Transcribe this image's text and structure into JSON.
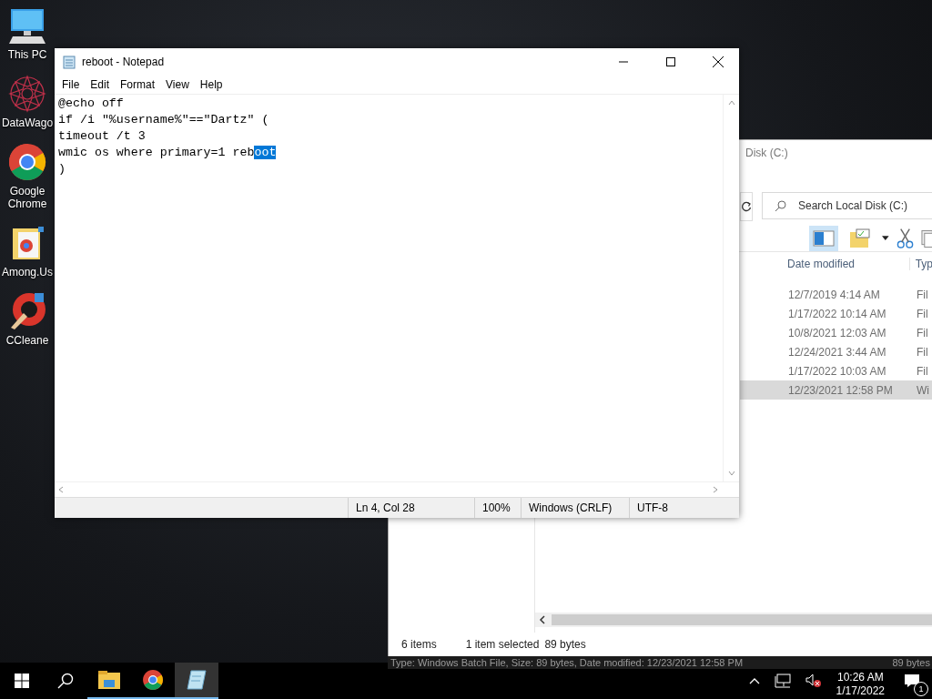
{
  "desktop_icons": [
    {
      "kind": "pc",
      "label": "This PC"
    },
    {
      "kind": "mandala",
      "label": "DataWago"
    },
    {
      "kind": "chrome",
      "label": "Google Chrome"
    },
    {
      "kind": "folder",
      "label": "Among.Us"
    },
    {
      "kind": "ccleaner",
      "label": "CCleane"
    }
  ],
  "explorer": {
    "title": "Disk (C:)",
    "search": {
      "placeholder": "Search Local Disk (C:)"
    },
    "columns": [
      "Date modified",
      "Typ"
    ],
    "rows": [
      {
        "date": "12/7/2019 4:14 AM",
        "type": "Fil",
        "selected": false
      },
      {
        "date": "1/17/2022 10:14 AM",
        "type": "Fil",
        "selected": false
      },
      {
        "date": "10/8/2021 12:03 AM",
        "type": "Fil",
        "selected": false
      },
      {
        "date": "12/24/2021 3:44 AM",
        "type": "Fil",
        "selected": false
      },
      {
        "date": "1/17/2022 10:03 AM",
        "type": "Fil",
        "selected": false
      },
      {
        "date": "12/23/2021 12:58 PM",
        "type": "Wi",
        "selected": true
      }
    ],
    "status": {
      "count": "6 items",
      "selection": "1 item selected",
      "size": "89 bytes"
    }
  },
  "tooltip": {
    "text": "Type: Windows Batch File, Size: 89 bytes, Date modified: 12/23/2021 12:58 PM",
    "extra": "89 bytes"
  },
  "notepad": {
    "title": "reboot - Notepad",
    "menu": [
      "File",
      "Edit",
      "Format",
      "View",
      "Help"
    ],
    "lines": [
      [
        {
          "text": "@echo off",
          "selected": false
        }
      ],
      [
        {
          "text": "if /i \"%username%\"==\"Dartz\" (",
          "selected": false
        }
      ],
      [
        {
          "text": "timeout /t 3",
          "selected": false
        }
      ],
      [
        {
          "text": "wmic os where primary=1 reb",
          "selected": false
        },
        {
          "text": "oot",
          "selected": true
        }
      ],
      [
        {
          "text": ")",
          "selected": false
        }
      ]
    ],
    "status": [
      "Ln 4, Col 28",
      "100%",
      "Windows (CRLF)",
      "UTF-8"
    ]
  },
  "taskbar": {
    "apps": [
      {
        "kind": "explorer",
        "active": false
      },
      {
        "kind": "chrome",
        "active": false
      },
      {
        "kind": "notepad",
        "active": true
      }
    ],
    "time": "10:26 AM",
    "date": "1/17/2022",
    "notifications": "1"
  }
}
